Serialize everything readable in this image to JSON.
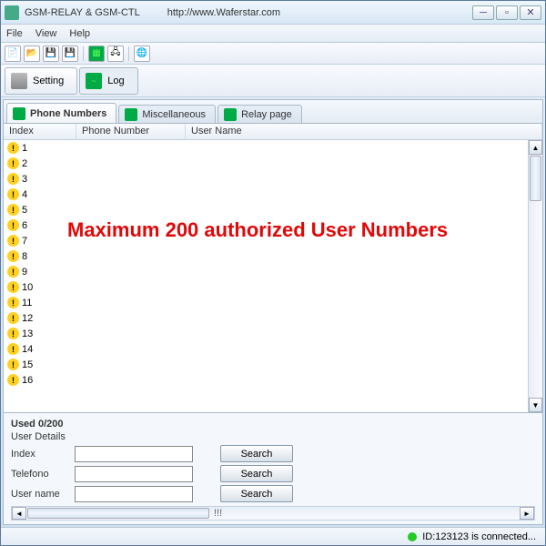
{
  "window": {
    "title": "GSM-RELAY & GSM-CTL",
    "url": "http://www.Waferstar.com"
  },
  "menu": {
    "file": "File",
    "view": "View",
    "help": "Help"
  },
  "bigtabs": {
    "setting": "Setting",
    "log": "Log"
  },
  "tabs": {
    "phone": "Phone Numbers",
    "misc": "Miscellaneous",
    "relay": "Relay page"
  },
  "columns": {
    "index": "Index",
    "phone": "Phone Number",
    "user": "User Name"
  },
  "rows": [
    {
      "idx": "1"
    },
    {
      "idx": "2"
    },
    {
      "idx": "3"
    },
    {
      "idx": "4"
    },
    {
      "idx": "5"
    },
    {
      "idx": "6"
    },
    {
      "idx": "7"
    },
    {
      "idx": "8"
    },
    {
      "idx": "9"
    },
    {
      "idx": "10"
    },
    {
      "idx": "11"
    },
    {
      "idx": "12"
    },
    {
      "idx": "13"
    },
    {
      "idx": "14"
    },
    {
      "idx": "15"
    },
    {
      "idx": "16"
    }
  ],
  "overlay": "Maximum 200 authorized User Numbers",
  "bottom": {
    "used": "Used 0/200",
    "details": "User Details",
    "index": "Index",
    "telefono": "Telefono",
    "username": "User name",
    "search": "Search",
    "scroll_marker": "!!!"
  },
  "status": {
    "text": "ID:123123 is connected..."
  }
}
